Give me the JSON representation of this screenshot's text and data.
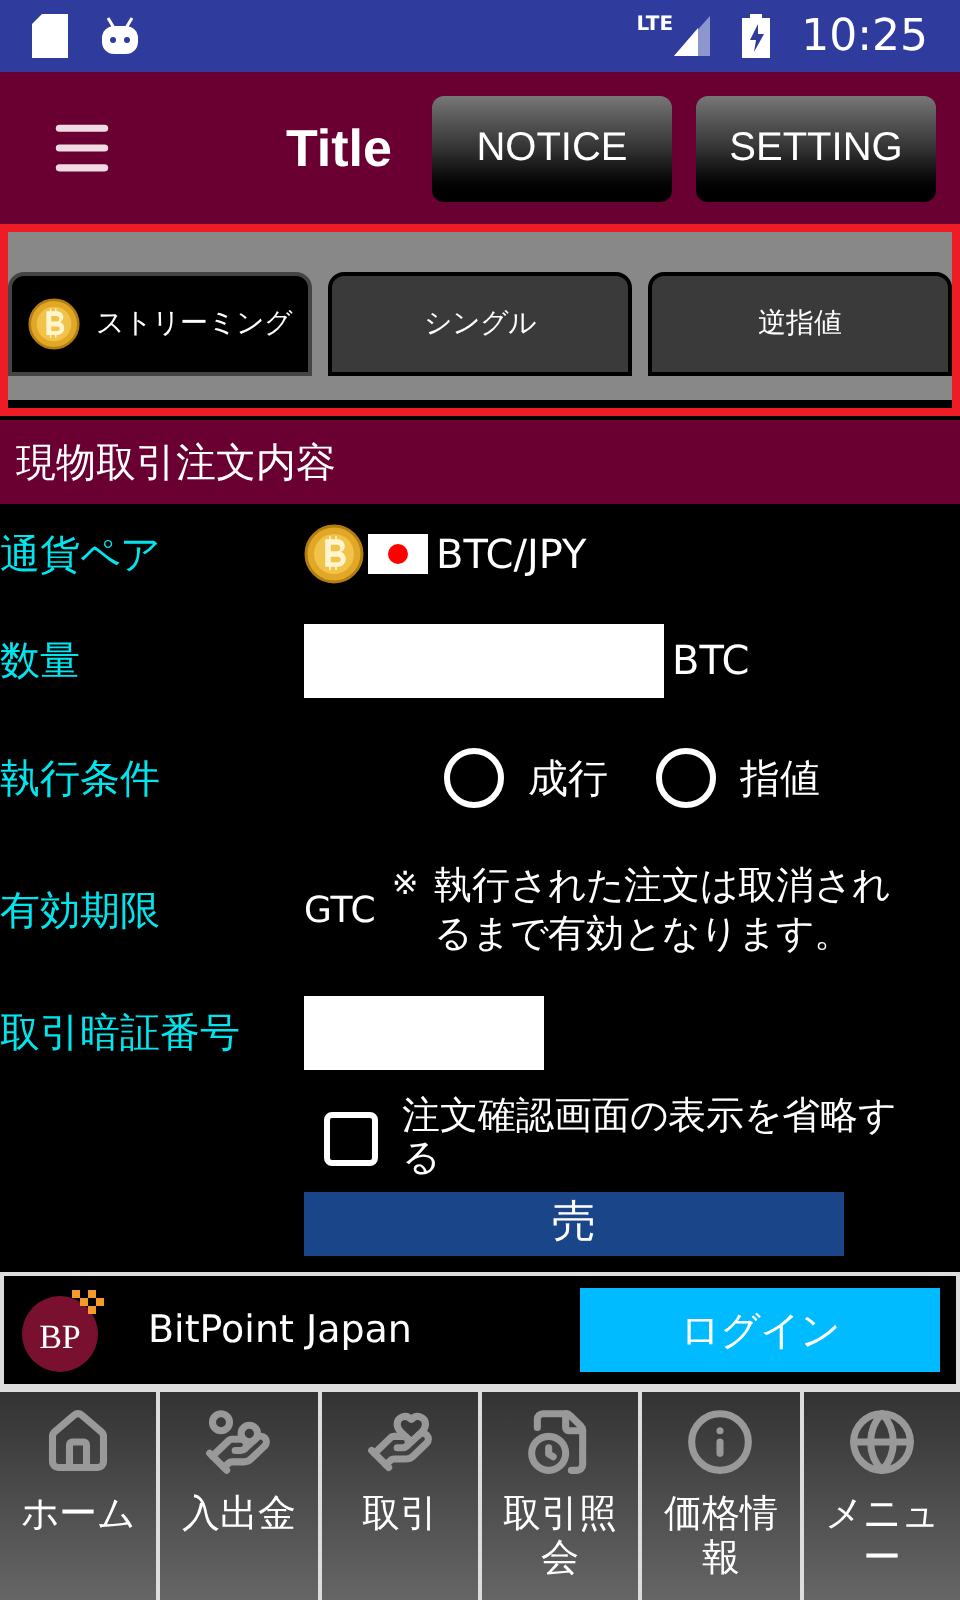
{
  "status_bar": {
    "network": "LTE",
    "time": "10:25"
  },
  "toolbar": {
    "title": "Title",
    "buttons": [
      "NOTICE",
      "SETTING"
    ]
  },
  "tabs": [
    {
      "label": "ストリーミング",
      "selected": true,
      "coin": true
    },
    {
      "label": "シングル",
      "selected": false,
      "coin": false
    },
    {
      "label": "逆指値",
      "selected": false,
      "coin": false
    }
  ],
  "section_title": "現物取引注文内容",
  "form": {
    "pair_label": "通貨ペア",
    "pair": "BTC/JPY",
    "quantity_label": "数量",
    "quantity_unit": "BTC",
    "condition_label": "執行条件",
    "conditions": [
      {
        "label": "成行",
        "selected": false
      },
      {
        "label": "指値",
        "selected": false
      }
    ],
    "expiry_label": "有効期限",
    "expiry": "GTC",
    "expiry_note_mark": "※",
    "expiry_note": "執行された注文は取消されるまで有効となります。",
    "pin_label": "取引暗証番号",
    "skip_confirm": {
      "label": "注文確認画面の表示を省略する",
      "checked": false
    },
    "submit": "売"
  },
  "banner": {
    "logo": "BP",
    "name": "BitPoint Japan",
    "login": "ログイン"
  },
  "bottom_nav": [
    {
      "kind": "home",
      "label": "ホーム"
    },
    {
      "kind": "deposit",
      "label": "入出金"
    },
    {
      "kind": "trade",
      "label": "取引"
    },
    {
      "kind": "history",
      "label": "取引照会"
    },
    {
      "kind": "info",
      "label": "価格情報"
    },
    {
      "kind": "globe",
      "label": "メニュー"
    }
  ]
}
